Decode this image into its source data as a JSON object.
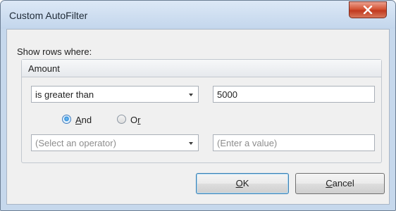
{
  "window": {
    "title": "Custom AutoFilter"
  },
  "show_rows_label": "Show rows where:",
  "group": {
    "title": "Amount",
    "condition1": {
      "operator": "is greater than",
      "value": "5000"
    },
    "logic": {
      "and_prefix": "",
      "and_accel": "A",
      "and_suffix": "nd",
      "or_prefix": "O",
      "or_accel": "r",
      "or_suffix": "",
      "selected": "And"
    },
    "condition2": {
      "operator_placeholder": "(Select an operator)",
      "value_placeholder": "(Enter a value)"
    }
  },
  "buttons": {
    "ok_accel": "O",
    "ok_rest": "K",
    "cancel_accel": "C",
    "cancel_rest": "ancel"
  },
  "icons": {
    "close": "close-x-icon",
    "dropdown": "chevron-down-icon"
  }
}
